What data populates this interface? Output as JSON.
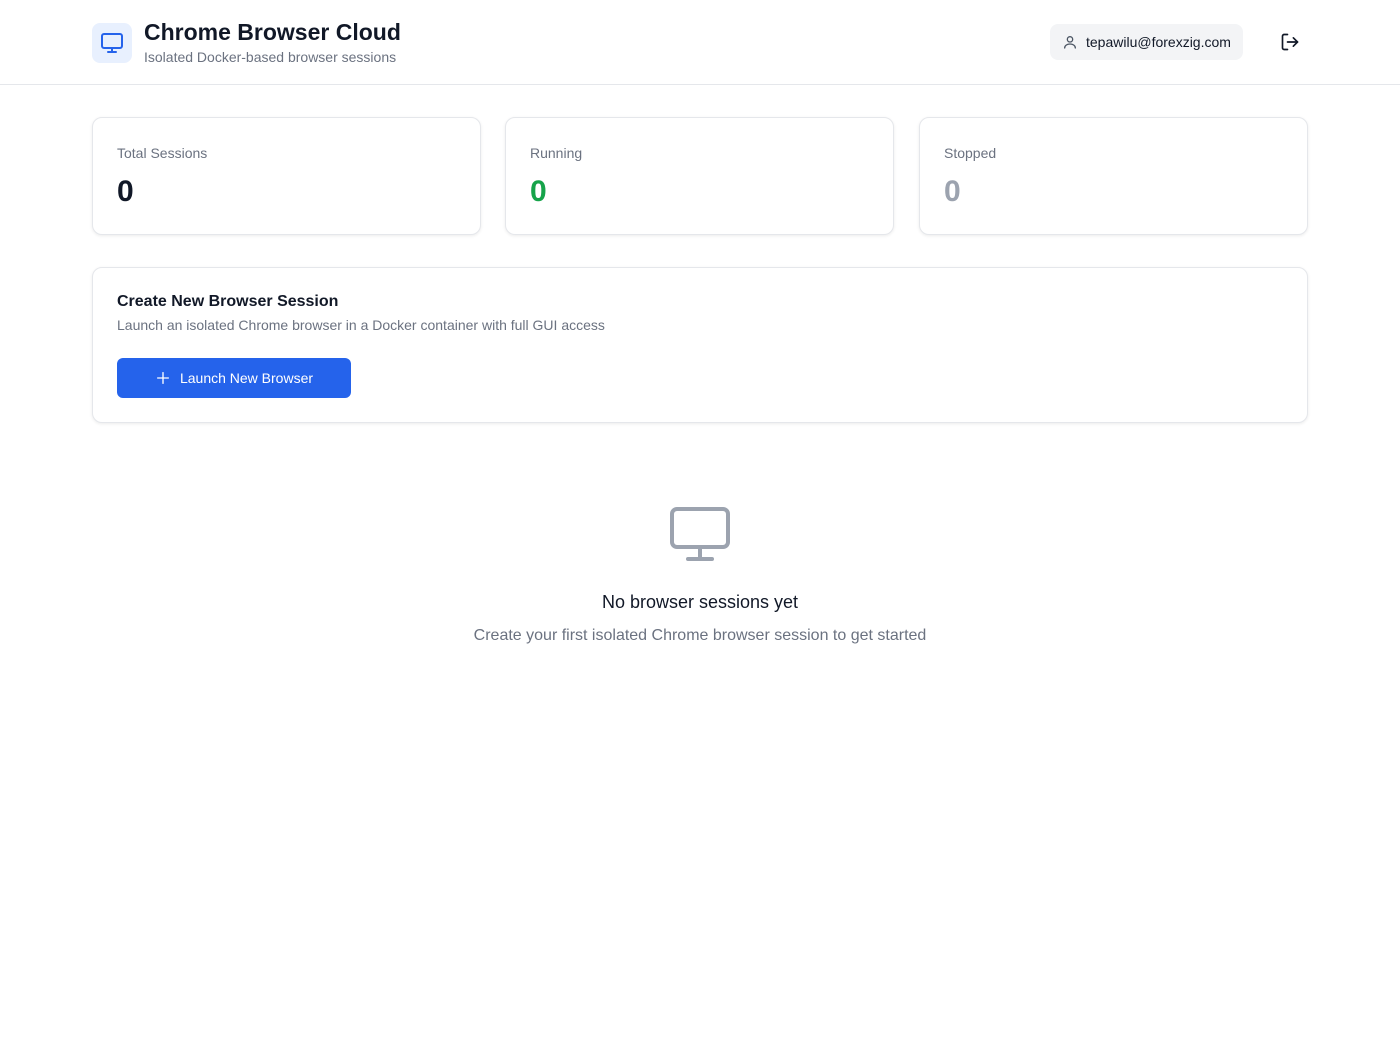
{
  "header": {
    "title": "Chrome Browser Cloud",
    "subtitle": "Isolated Docker-based browser sessions",
    "logo_icon": "monitor-icon",
    "user_email": "tepawilu@forexzig.com",
    "user_icon": "user-icon",
    "logout_icon": "logout-icon"
  },
  "stats": [
    {
      "label": "Total Sessions",
      "value": "0",
      "color": "#111827"
    },
    {
      "label": "Running",
      "value": "0",
      "color": "#16a34a"
    },
    {
      "label": "Stopped",
      "value": "0",
      "color": "#9ca3af"
    }
  ],
  "create": {
    "title": "Create New Browser Session",
    "description": "Launch an isolated Chrome browser in a Docker container with full GUI access",
    "button_label": "Launch New Browser",
    "button_icon": "plus-icon"
  },
  "empty_state": {
    "icon": "monitor-icon",
    "title": "No browser sessions yet",
    "description": "Create your first isolated Chrome browser session to get started"
  },
  "colors": {
    "accent": "#2563eb",
    "running": "#16a34a",
    "stopped": "#9ca3af"
  }
}
